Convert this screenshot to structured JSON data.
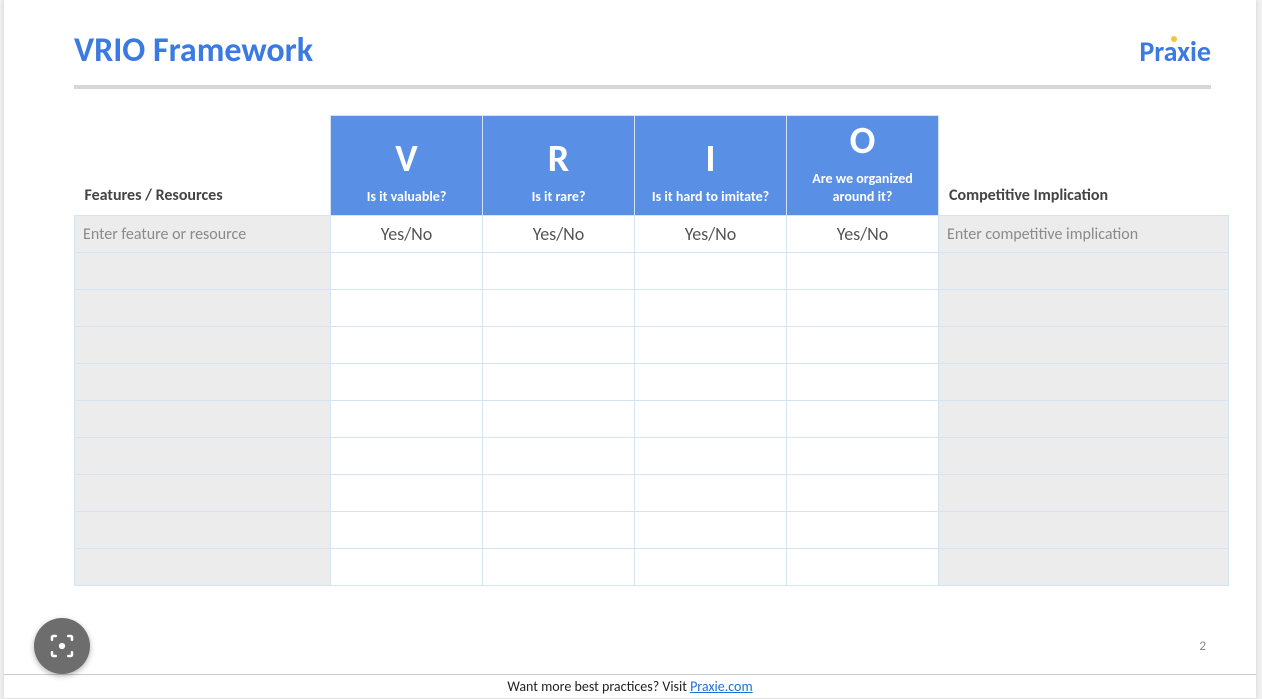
{
  "title": "VRIO Framework",
  "brand": "Praxie",
  "table": {
    "headers": {
      "feature": "Features / Resources",
      "v": {
        "letter": "V",
        "question": "Is it valuable?"
      },
      "r": {
        "letter": "R",
        "question": "Is it rare?"
      },
      "i": {
        "letter": "I",
        "question": "Is it hard to imitate?"
      },
      "o": {
        "letter": "O",
        "question": "Are we organized around it?"
      },
      "implication": "Competitive Implication"
    },
    "row0": {
      "feature_placeholder": "Enter feature or resource",
      "v": "Yes/No",
      "r": "Yes/No",
      "i": "Yes/No",
      "o": "Yes/No",
      "implication_placeholder": "Enter competitive implication"
    },
    "empty_rows": 9
  },
  "page_number": "2",
  "footer": {
    "text_before": "Want more best practices? Visit ",
    "link_text": "Praxie.com"
  }
}
